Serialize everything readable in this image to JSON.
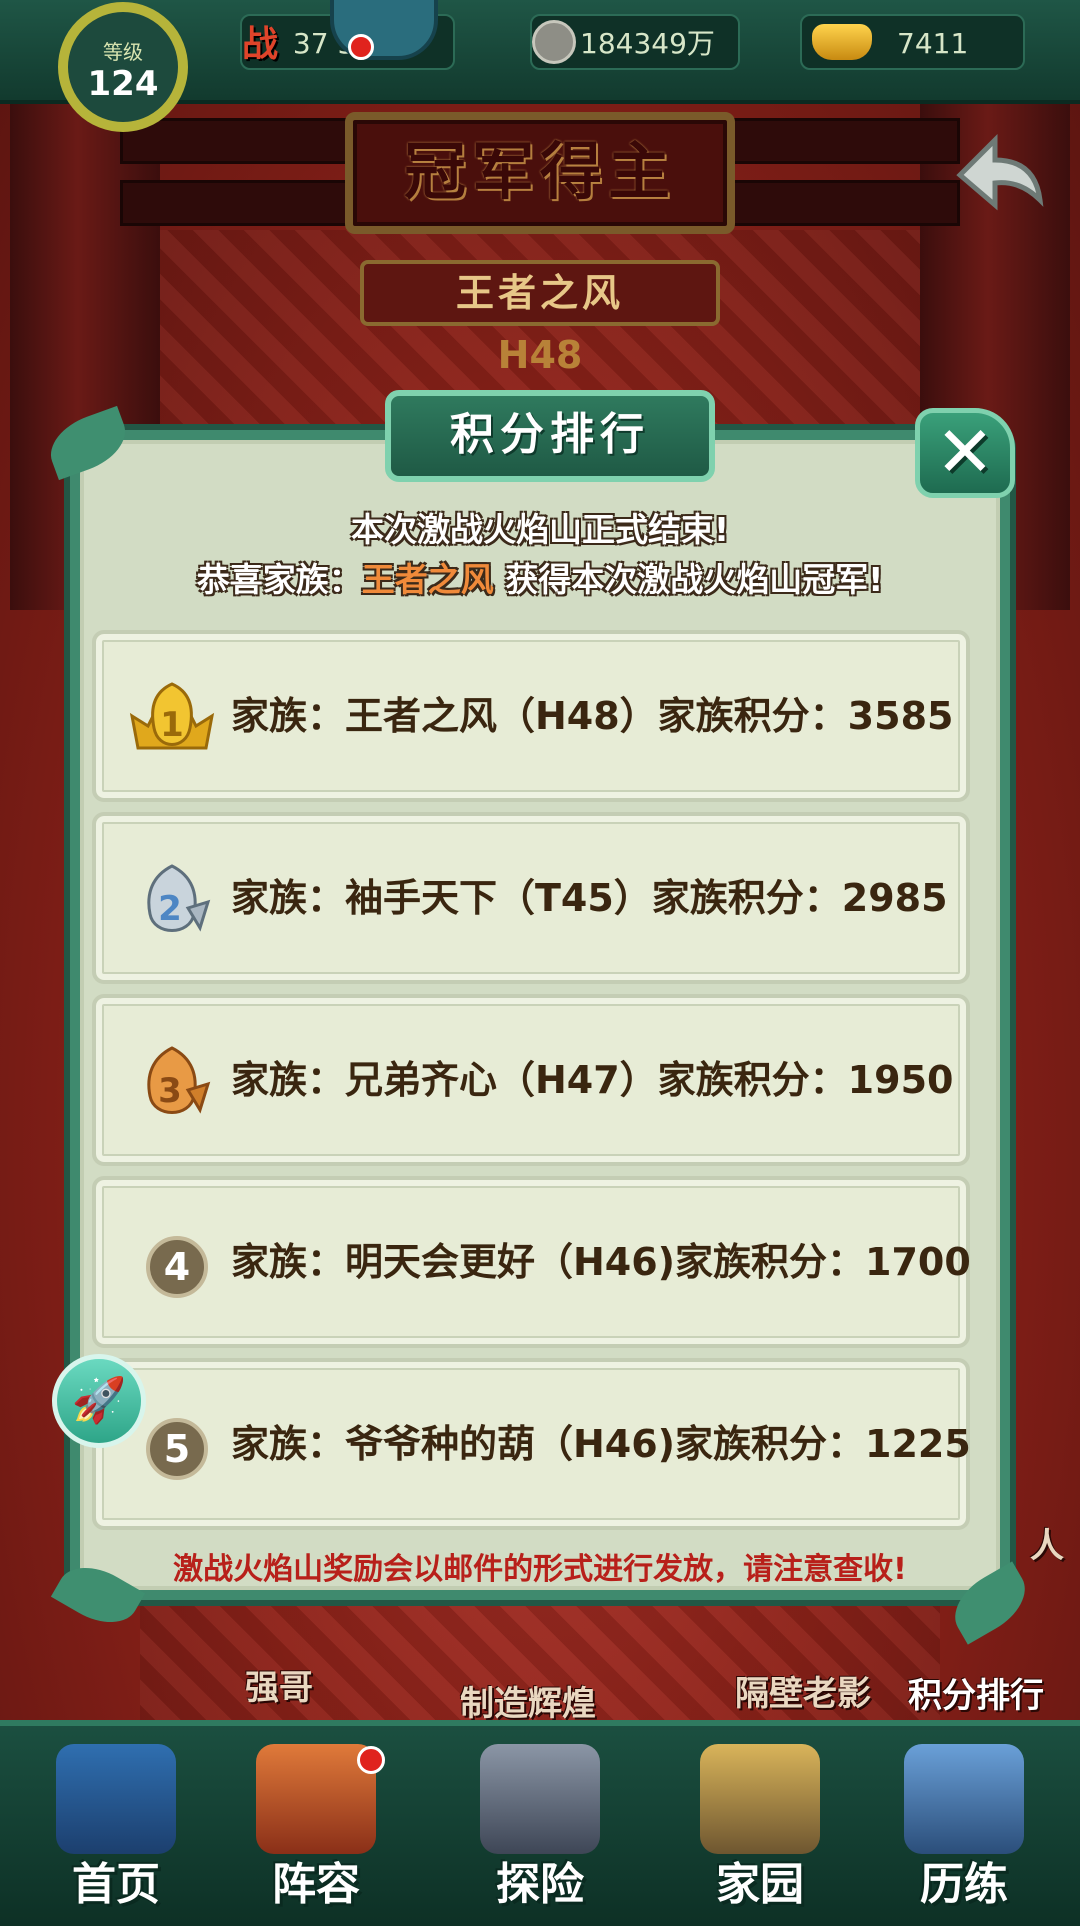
{
  "topbar": {
    "level_label": "等级",
    "level_value": "124",
    "power_icon": "战",
    "power_value": "37 3万",
    "coins_value": "184349万",
    "gold_value": "7411"
  },
  "banner": {
    "title": "冠军得主",
    "champion_family": "王者之风",
    "server": "H48"
  },
  "popup": {
    "header": "积分排行",
    "close_glyph": "✕",
    "announce_line1": "本次激战火焰山正式结束!",
    "announce_line2_prefix": "恭喜家族：",
    "announce_champion": "王者之风",
    "announce_line2_suffix": " 获得本次激战火焰山冠军!",
    "rankings": [
      {
        "rank": "1",
        "text": "家族：王者之风（H48）家族积分：3585",
        "medal": "gold"
      },
      {
        "rank": "2",
        "text": "家族：袖手天下（T45）家族积分：2985",
        "medal": "silver"
      },
      {
        "rank": "3",
        "text": "家族：兄弟齐心（H47）家族积分：1950",
        "medal": "bronze"
      },
      {
        "rank": "4",
        "text": "家族：明天会更好（H46)家族积分：1700",
        "medal": "none"
      },
      {
        "rank": "5",
        "text": "家族：爷爷种的葫（H46)家族积分：1225",
        "medal": "none"
      }
    ],
    "footer_note": "激战火焰山奖励会以邮件的形式进行发放，请注意查收!"
  },
  "background_labels": {
    "left": "强哥",
    "center": "制造辉煌",
    "right": "隔壁老影",
    "ranking_button": "积分排行",
    "side_partial": "人"
  },
  "nav": {
    "items": [
      {
        "label": "首页",
        "icon": "home-pavilion-icon"
      },
      {
        "label": "阵容",
        "icon": "lineup-gourds-icon"
      },
      {
        "label": "探险",
        "icon": "explore-gate-icon"
      },
      {
        "label": "家园",
        "icon": "homestead-house-icon"
      },
      {
        "label": "历练",
        "icon": "training-mountain-icon"
      }
    ]
  },
  "colors": {
    "panel_green": "#3f8a6e",
    "panel_fill": "#d2dcc4",
    "champion_orange": "#f08a3a",
    "note_red": "#b8201a",
    "gold": "#f2c531",
    "silver": "#c9d4dc",
    "bronze": "#e89a45"
  }
}
